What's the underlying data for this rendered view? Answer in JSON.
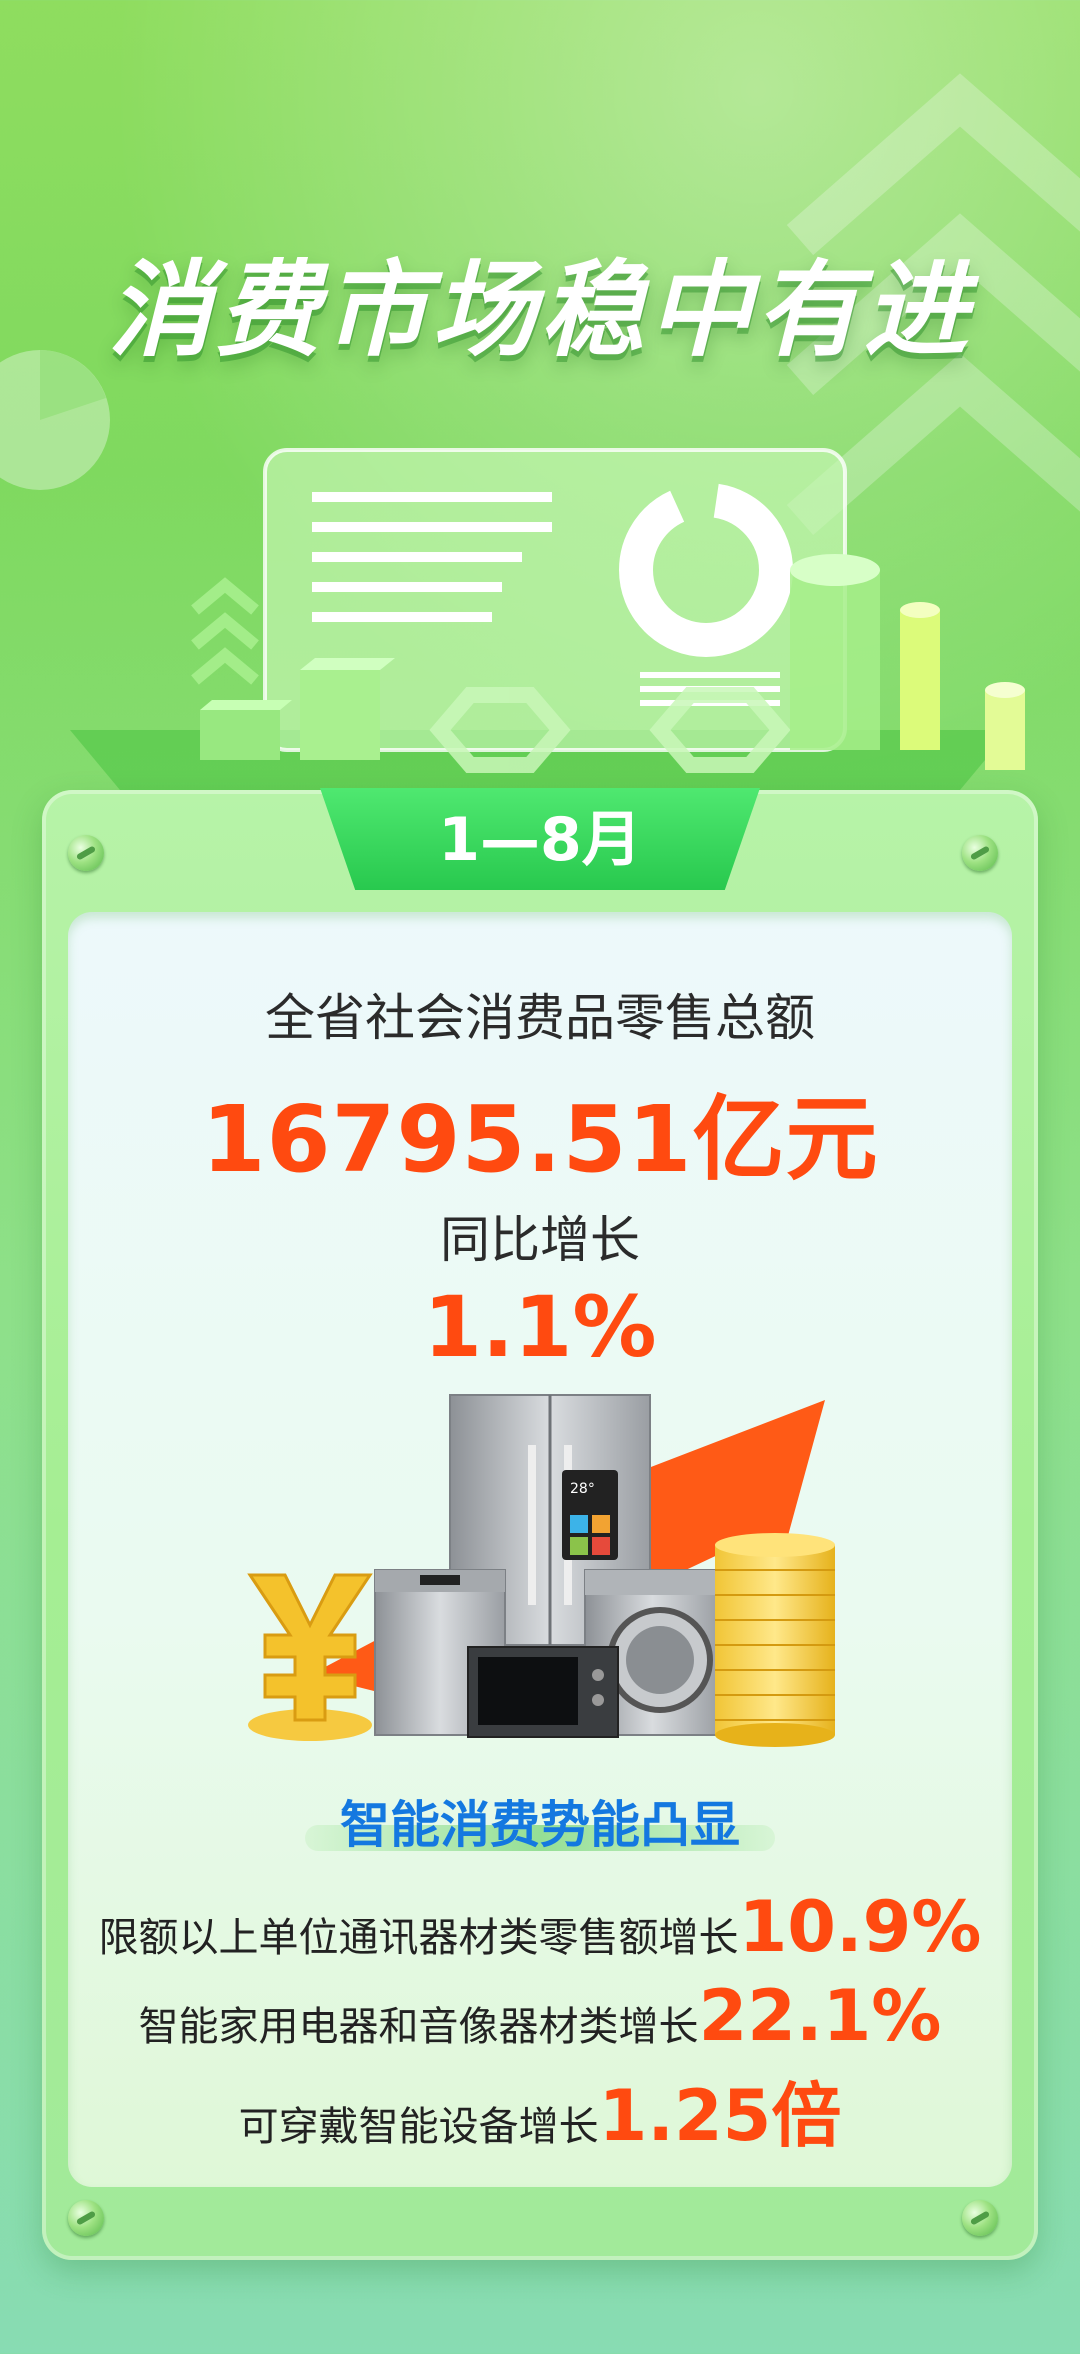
{
  "headline": "消费市场稳中有进",
  "period_tab": "1—8月",
  "metric": {
    "label": "全省社会消费品零售总额",
    "value": "16795.51亿元",
    "growth_label": "同比增长",
    "growth_value": "1.1%"
  },
  "section_title": "智能消费势能凸显",
  "stats": [
    {
      "label": "限额以上单位通讯器材类零售额增长",
      "value": "10.9%"
    },
    {
      "label": "智能家用电器和音像器材类增长",
      "value": "22.1%"
    },
    {
      "label": "可穿戴智能设备增长",
      "value": "1.25倍"
    }
  ],
  "illustration_display": "28°",
  "colors": {
    "accent_value": "#ff4a10",
    "section_title": "#1478e0",
    "tab_green": "#28c94e",
    "background_green": "#8fdd5f"
  },
  "icons": [
    "yuan-icon",
    "fridge-icon",
    "dishwasher-icon",
    "microwave-icon",
    "washing-machine-icon",
    "coin-stack-icon",
    "growth-arrow-icon",
    "donut-chart-icon",
    "bar-chart-icon"
  ]
}
